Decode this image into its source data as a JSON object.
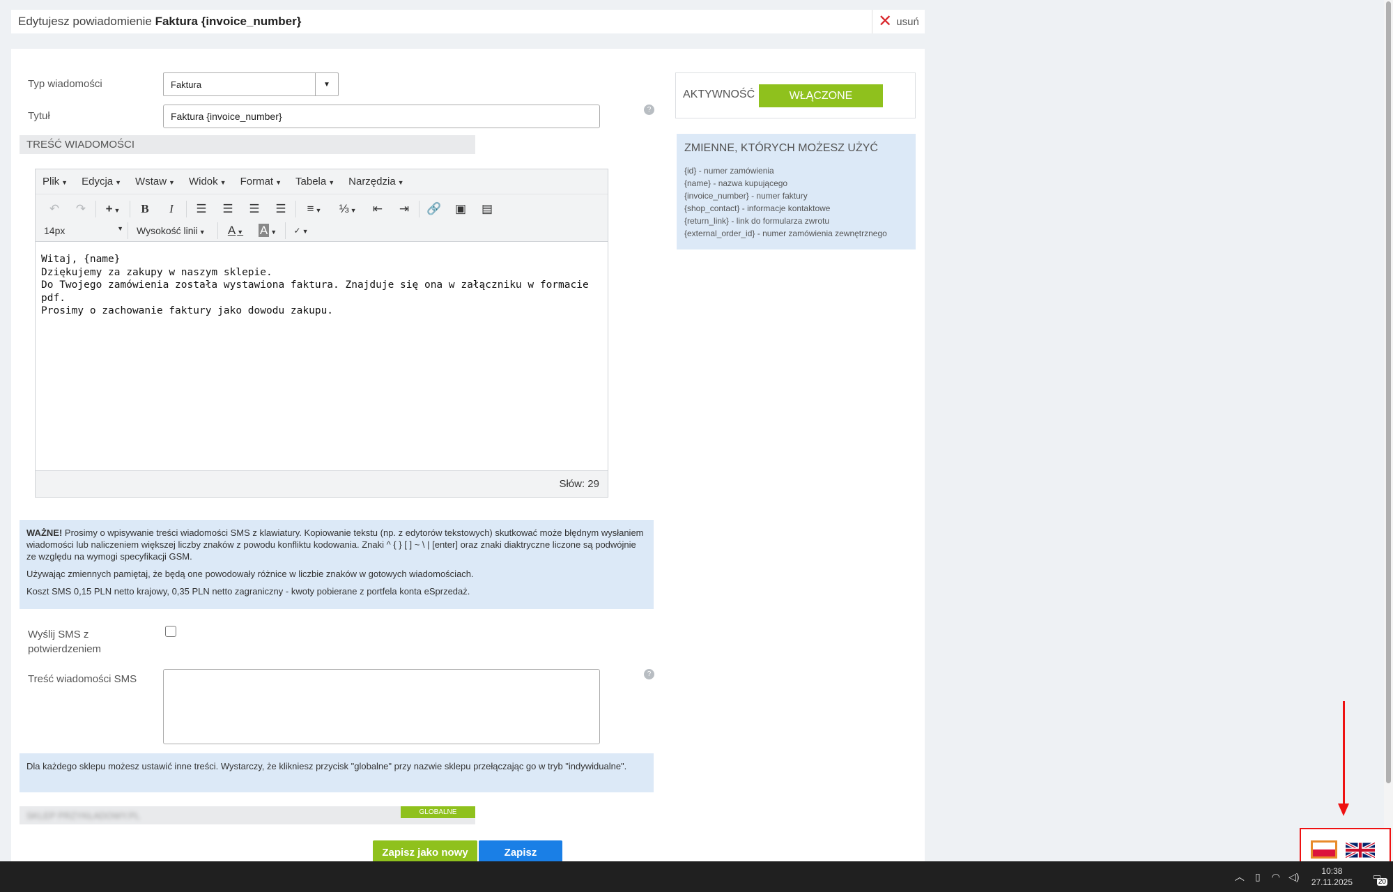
{
  "header": {
    "prefix": "Edytujesz powiadomienie",
    "name": "Faktura {invoice_number}",
    "delete_label": "usuń"
  },
  "form": {
    "type_label": "Typ wiadomości",
    "type_value": "Faktura",
    "title_label": "Tytuł",
    "title_value": "Faktura {invoice_number}",
    "content_section": "TREŚĆ WIADOMOŚCI",
    "sms_confirm_label_1": "Wyślij SMS z",
    "sms_confirm_label_2": "potwierdzeniem",
    "sms_confirm_checked": false,
    "sms_content_label": "Treść wiadomości SMS",
    "sms_content_value": ""
  },
  "editor": {
    "menu": [
      "Plik",
      "Edycja",
      "Wstaw",
      "Widok",
      "Format",
      "Tabela",
      "Narzędzia"
    ],
    "font_size": "14px",
    "line_height_label": "Wysokość linii",
    "content_lines": [
      "Witaj, {name}",
      "Dziękujemy za zakupy w naszym sklepie.",
      "Do Twojego zamówienia została wystawiona faktura. Znajduje się ona w załączniku w formacie pdf.",
      "Prosimy o zachowanie faktury jako dowodu zakupu."
    ],
    "word_count": "Słów: 29"
  },
  "warning": {
    "bold": "WAŻNE!",
    "text": " Prosimy o wpisywanie treści wiadomości SMS z klawiatury. Kopiowanie tekstu (np. z edytorów tekstowych) skutkować może błędnym wysłaniem wiadomości lub naliczeniem większej liczby znaków z powodu konfliktu kodowania. Znaki ^ { } [ ] ~ \\ | [enter] oraz znaki diaktryczne liczone są podwójnie ze względu na wymogi specyfikacji GSM.",
    "variables_note": "Używając zmiennych pamiętaj, że będą one powodowały różnice w liczbie znaków w gotowych wiadomościach.",
    "cost_note": "Koszt SMS 0,15 PLN netto krajowy, 0,35 PLN netto zagraniczny - kwoty pobierane z portfela konta eSprzedaż."
  },
  "shop_info": "Dla każdego sklepu możesz ustawić inne treści. Wystarczy, że klikniesz przycisk \"globalne\" przy nazwie sklepu przełączając go w tryb \"indywidualne\".",
  "shop": {
    "name": "SKLEP PRZYKŁADOWY.PL",
    "badge": "GLOBALNE"
  },
  "buttons": {
    "save_new": "Zapisz jako nowy",
    "save": "Zapisz"
  },
  "activity": {
    "label": "AKTYWNOŚĆ",
    "state": "WŁĄCZONE"
  },
  "variables": {
    "title": "ZMIENNE, KTÓRYCH MOŻESZ UŻYĆ",
    "items": [
      "{id} - numer zamówienia",
      "{name} - nazwa kupującego",
      "{invoice_number} - numer faktury",
      "{shop_contact} - informacje kontaktowe",
      "{return_link} - link do formularza zwrotu",
      "{external_order_id} - numer zamówienia zewnętrznego"
    ]
  },
  "taskbar": {
    "time": "10:38",
    "date": "27.11.2025",
    "notifications": "20"
  },
  "colors": {
    "accent_green": "#8fc11d",
    "accent_blue": "#1a7fe6",
    "info_bg": "#dce9f7",
    "annotation_red": "#e11"
  }
}
